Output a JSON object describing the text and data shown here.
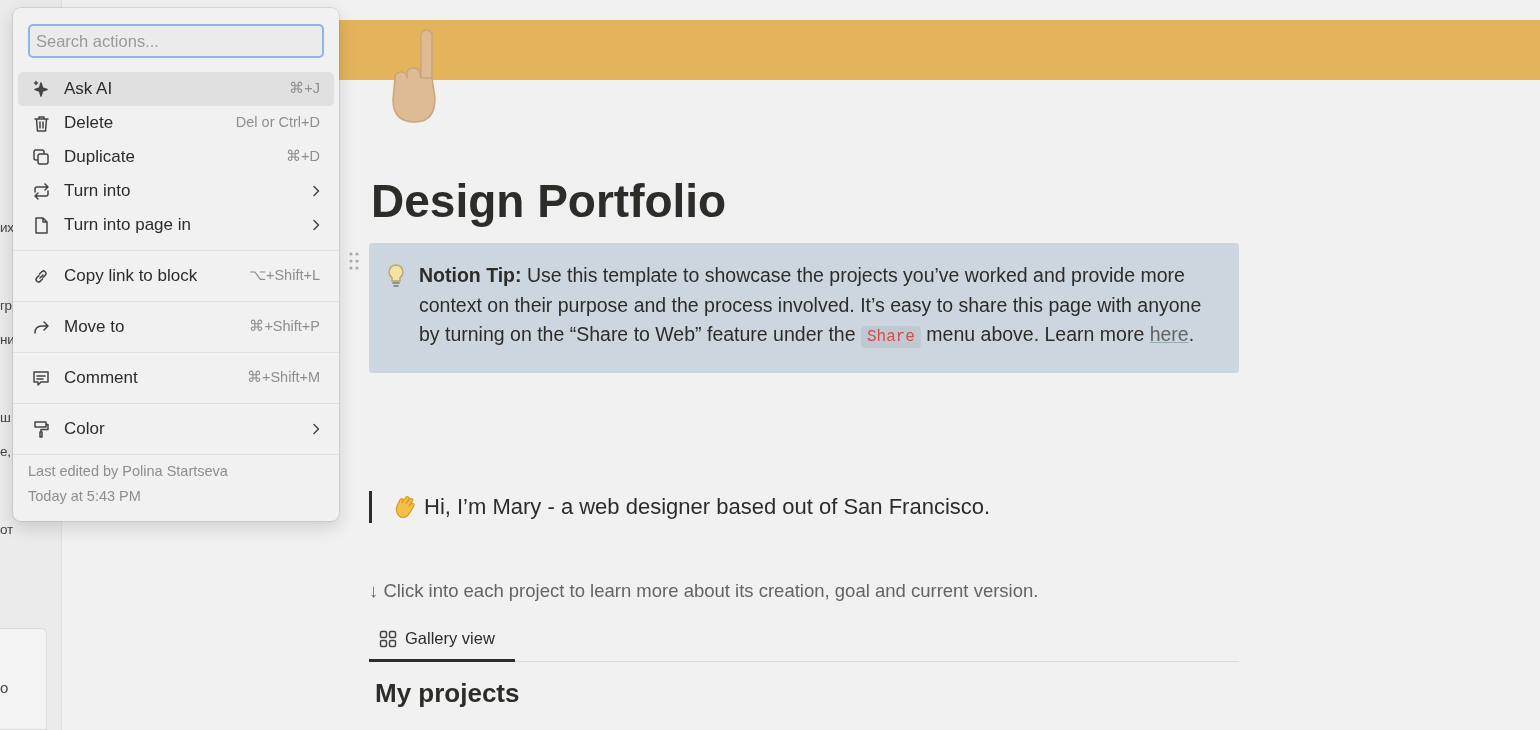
{
  "sidebar": {
    "items": [
      {
        "label": "их"
      },
      {
        "label": "гр"
      },
      {
        "label": "ни"
      },
      {
        "label": "ш"
      },
      {
        "label": "е,"
      },
      {
        "label": "от"
      }
    ],
    "card": {
      "label": "о"
    }
  },
  "page": {
    "title": "Design Portfolio",
    "callout": {
      "text": "**Notion Tip:** Use this template to showcase the projects you’ve worked and provide more context on their purpose and the process involved. It’s easy to share this page with anyone by turning on the “Share to Web” feature under the ",
      "code": "Share",
      "text_after": " menu above. Learn more ",
      "link": "here",
      "end": "."
    },
    "quote": "Hi, I’m Mary - a web designer based out of San Francisco.",
    "description": "↓ Click into each project to learn more about its creation, goal and current version.",
    "views": [
      {
        "label": "Gallery view",
        "selected": true
      }
    ],
    "section_title": "My projects"
  },
  "menu": {
    "search": {
      "placeholder": "Search actions..."
    },
    "groups": [
      [
        {
          "label": "Ask AI",
          "shortcut": "⌘+J",
          "kind": "shortcut",
          "selected": true
        },
        {
          "label": "Delete",
          "shortcut": "Del or Ctrl+D",
          "kind": "shortcut",
          "selected": false
        },
        {
          "label": "Duplicate",
          "shortcut": "⌘+D",
          "kind": "shortcut",
          "selected": false
        },
        {
          "label": "Turn into",
          "kind": "submenu",
          "selected": false
        },
        {
          "label": "Turn into page in",
          "kind": "submenu",
          "selected": false
        }
      ],
      [
        {
          "label": "Copy link to block",
          "shortcut": "⌥+Shift+L",
          "kind": "shortcut",
          "selected": false
        }
      ],
      [
        {
          "label": "Move to",
          "shortcut": "⌘+Shift+P",
          "kind": "shortcut",
          "selected": false
        }
      ],
      [
        {
          "label": "Comment",
          "shortcut": "⌘+Shift+M",
          "kind": "shortcut",
          "selected": false
        }
      ],
      [
        {
          "label": "Color",
          "kind": "submenu",
          "selected": false
        }
      ]
    ],
    "footer": {
      "edited_by": "Last edited by Polina Startseva",
      "time": "Today at 5:43 PM"
    }
  }
}
